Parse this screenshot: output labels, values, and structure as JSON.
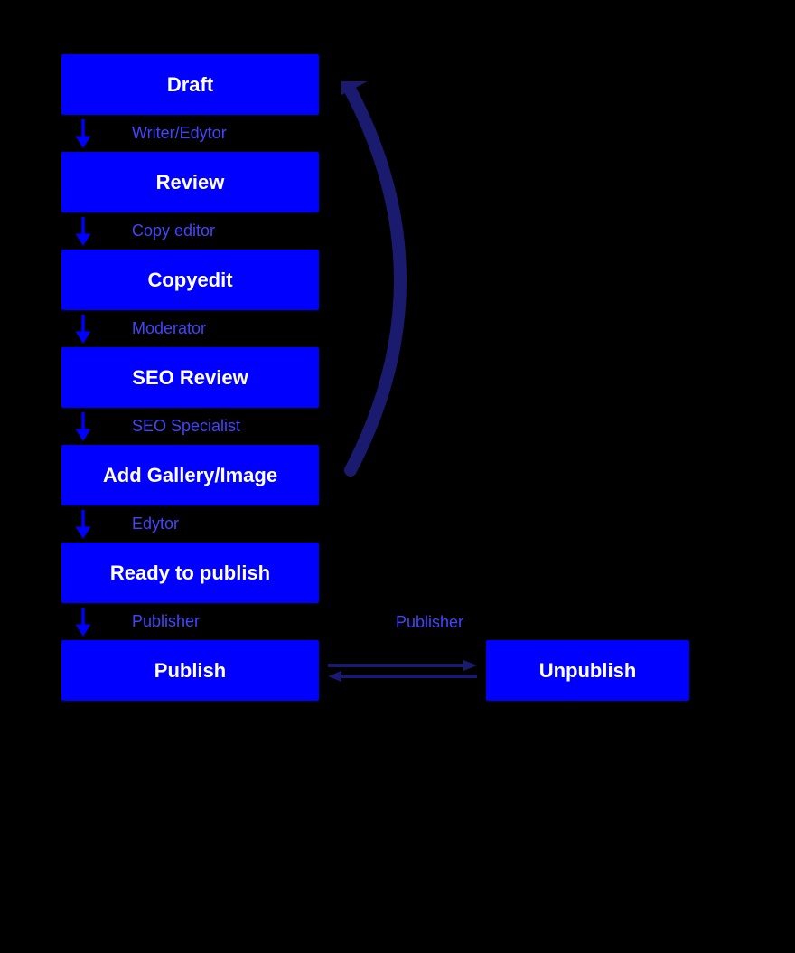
{
  "states": [
    {
      "id": "draft",
      "label": "Draft"
    },
    {
      "id": "review",
      "label": "Review"
    },
    {
      "id": "copyedit",
      "label": "Copyedit"
    },
    {
      "id": "seo-review",
      "label": "SEO Review"
    },
    {
      "id": "add-gallery",
      "label": "Add Gallery/Image"
    },
    {
      "id": "ready-to-publish",
      "label": "Ready to publish"
    },
    {
      "id": "publish",
      "label": "Publish"
    }
  ],
  "roles": [
    {
      "id": "writer-editor",
      "label": "Writer/Edytor"
    },
    {
      "id": "copy-editor",
      "label": "Copy editor"
    },
    {
      "id": "moderator",
      "label": "Moderator"
    },
    {
      "id": "seo-specialist",
      "label": "SEO Specialist"
    },
    {
      "id": "edytor",
      "label": "Edytor"
    },
    {
      "id": "publisher-down",
      "label": "Publisher"
    }
  ],
  "unpublish": {
    "label": "Unpublish"
  },
  "publisher-middle": {
    "label": "Publisher"
  },
  "colors": {
    "blue": "#0000ff",
    "dark-navy": "#1a1a6e",
    "role-blue": "#5555ff"
  }
}
